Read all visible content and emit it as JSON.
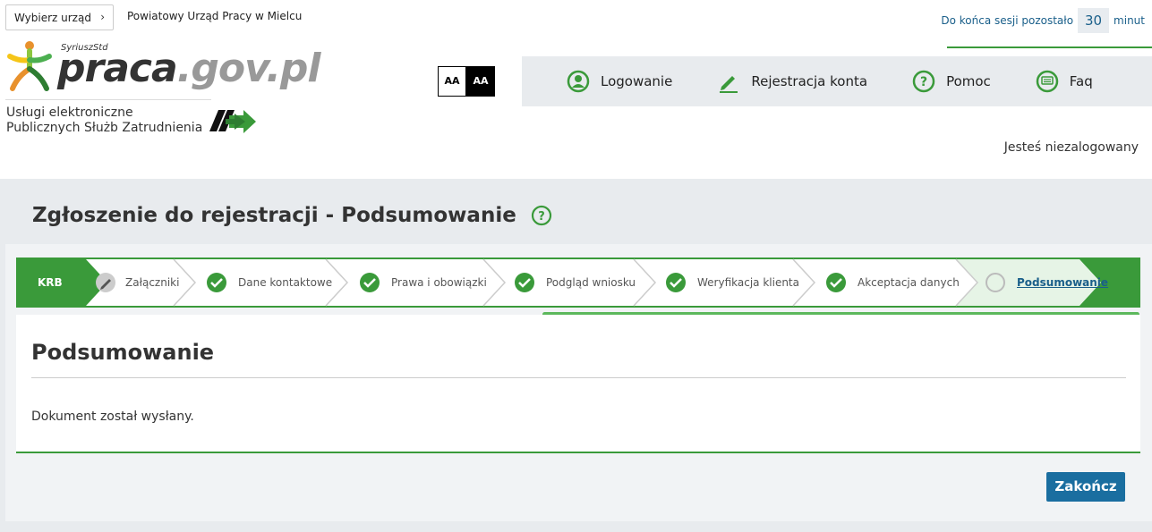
{
  "header": {
    "office_select_label": "Wybierz urząd",
    "office_name": "Powiatowy Urząd Pracy w Mielcu",
    "session_prefix": "Do końca sesji pozostało",
    "session_minutes": "30",
    "session_suffix": "minut"
  },
  "logo": {
    "superscript": "SyriuszStd",
    "text_main": "praca",
    "text_rest": ".gov.pl",
    "services_line1": "Usługi elektroniczne",
    "services_line2": "Publicznych Służb Zatrudnienia"
  },
  "contrast": {
    "light_label": "AA",
    "dark_label": "AA"
  },
  "nav": [
    {
      "label": "Logowanie",
      "icon": "user-icon"
    },
    {
      "label": "Rejestracja konta",
      "icon": "pencil-icon"
    },
    {
      "label": "Pomoc",
      "icon": "help-icon"
    },
    {
      "label": "Faq",
      "icon": "chat-icon"
    }
  ],
  "login_state": "Jesteś niezalogowany",
  "page_title": "Zgłoszenie do rejestracji - Podsumowanie",
  "steps": [
    {
      "label": "KRB",
      "state": "start"
    },
    {
      "label": "Załączniki",
      "state": "editing"
    },
    {
      "label": "Dane kontaktowe",
      "state": "done"
    },
    {
      "label": "Prawa i obowiązki",
      "state": "done"
    },
    {
      "label": "Podgląd wniosku",
      "state": "done"
    },
    {
      "label": "Weryfikacja klienta",
      "state": "done"
    },
    {
      "label": "Akceptacja danych",
      "state": "done"
    },
    {
      "label": "Podsumowanie",
      "state": "active"
    }
  ],
  "content": {
    "heading": "Podsumowanie",
    "message": "Dokument został wysłany."
  },
  "finish_button": "Zakończ",
  "colors": {
    "accent_green": "#3a9a3a",
    "link_blue": "#1a5f8a",
    "panel_grey": "#e8ebee"
  }
}
